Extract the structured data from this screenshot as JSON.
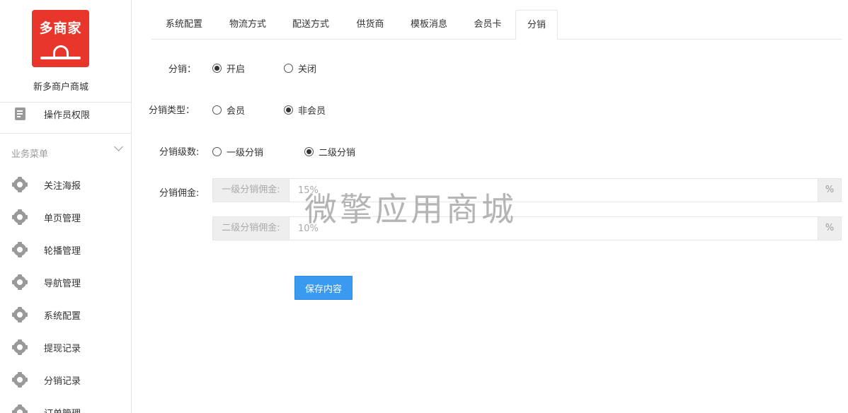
{
  "sidebar": {
    "logo_text": "多商家",
    "shop_name": "新多商户商城",
    "top_item": {
      "label": "操作员权限",
      "icon": "document-edit-icon"
    },
    "section_label": "业务菜单",
    "items": [
      {
        "label": "关注海报",
        "icon": "gear-icon"
      },
      {
        "label": "单页管理",
        "icon": "gear-icon"
      },
      {
        "label": "轮播管理",
        "icon": "gear-icon"
      },
      {
        "label": "导航管理",
        "icon": "gear-icon"
      },
      {
        "label": "系统配置",
        "icon": "gear-icon"
      },
      {
        "label": "提现记录",
        "icon": "gear-icon"
      },
      {
        "label": "分销记录",
        "icon": "gear-icon"
      },
      {
        "label": "订单管理",
        "icon": "gear-icon"
      }
    ]
  },
  "tabs": [
    {
      "label": "系统配置",
      "active": false
    },
    {
      "label": "物流方式",
      "active": false
    },
    {
      "label": "配送方式",
      "active": false
    },
    {
      "label": "供货商",
      "active": false
    },
    {
      "label": "模板消息",
      "active": false
    },
    {
      "label": "会员卡",
      "active": false
    },
    {
      "label": "分销",
      "active": true
    }
  ],
  "form": {
    "distribution": {
      "label": "分销：",
      "options": [
        {
          "label": "开启",
          "checked": true
        },
        {
          "label": "关闭",
          "checked": false
        }
      ]
    },
    "distribution_type": {
      "label": "分销类型：",
      "options": [
        {
          "label": "会员",
          "checked": false
        },
        {
          "label": "非会员",
          "checked": true
        }
      ]
    },
    "distribution_levels": {
      "label": "分销级数:",
      "options": [
        {
          "label": "一级分销",
          "checked": false
        },
        {
          "label": "二级分销",
          "checked": true
        }
      ]
    },
    "commission": {
      "label": "分销佣金:",
      "level1": {
        "addon": "一级分销佣金:",
        "value": "15%",
        "suffix": "%"
      },
      "level2": {
        "addon": "二级分销佣金:",
        "value": "10%",
        "suffix": "%"
      }
    },
    "save_label": "保存内容"
  },
  "watermark": "微擎应用商城",
  "colors": {
    "logo_red": "#e8362d",
    "primary_button": "#3a9af0",
    "icon_gray": "#999999"
  }
}
